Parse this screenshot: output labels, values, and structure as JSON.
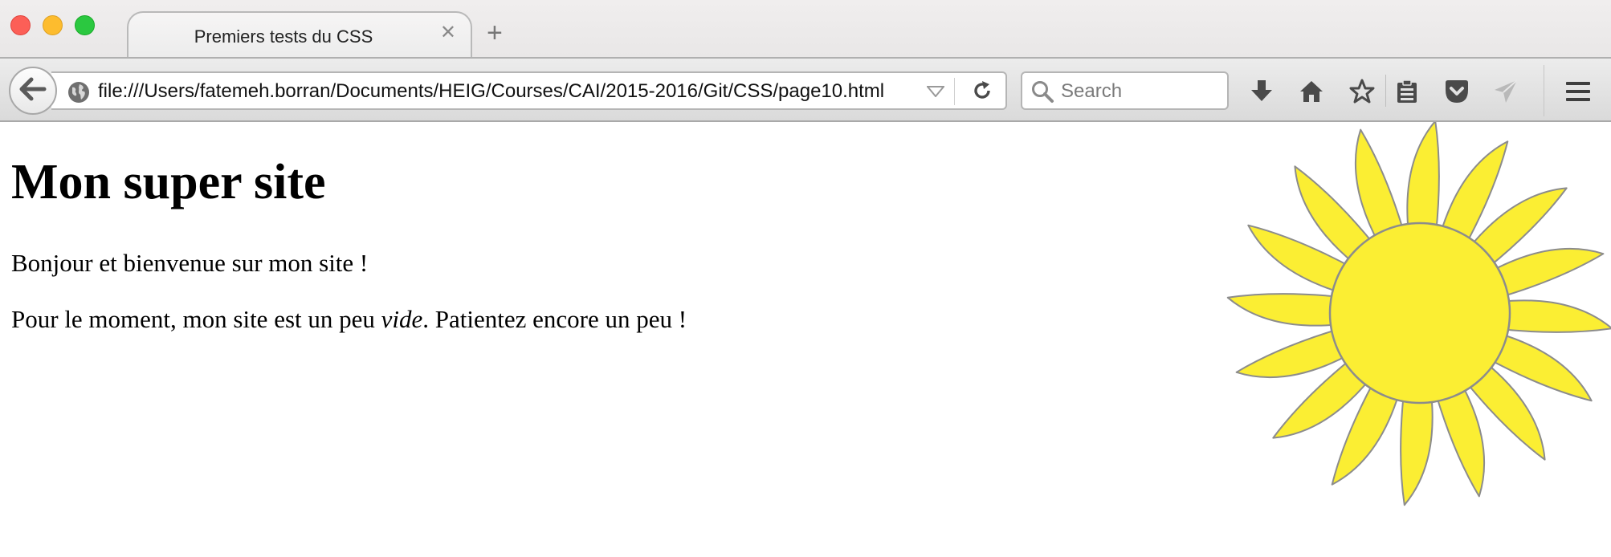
{
  "window": {
    "controls": [
      "close",
      "minimize",
      "zoom"
    ]
  },
  "tab": {
    "title": "Premiers tests du CSS",
    "close_glyph": "✕",
    "new_tab_glyph": "+"
  },
  "navbar": {
    "url": "file:///Users/fatemeh.borran/Documents/HEIG/Courses/CAI/2015-2016/Git/CSS/page10.html",
    "search_placeholder": "Search",
    "icons": [
      "back-icon",
      "globe-icon",
      "dropmarker-icon",
      "reload-icon",
      "search-icon",
      "download-icon",
      "home-icon",
      "bookmark-star-icon",
      "reading-list-icon",
      "pocket-icon",
      "share-icon",
      "menu-icon"
    ]
  },
  "page": {
    "heading": "Mon super site",
    "para1": "Bonjour et bienvenue sur mon site !",
    "para2_before": "Pour le moment, mon site est un peu ",
    "para2_emph": "vide",
    "para2_after": ". Patientez encore un peu !",
    "image_icon": "sun-icon",
    "sun_color": "#fbee33"
  }
}
